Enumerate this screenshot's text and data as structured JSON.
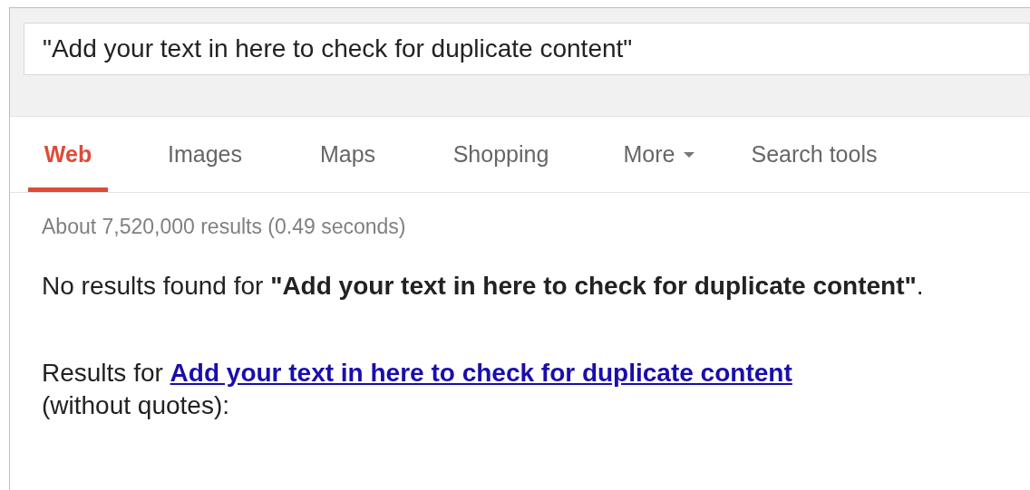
{
  "search": {
    "value": "\"Add your text in here to check for duplicate content\""
  },
  "tabs": [
    {
      "label": "Web",
      "selected": true,
      "kind": "tab"
    },
    {
      "label": "Images",
      "selected": false,
      "kind": "tab"
    },
    {
      "label": "Maps",
      "selected": false,
      "kind": "tab"
    },
    {
      "label": "Shopping",
      "selected": false,
      "kind": "tab"
    },
    {
      "label": "More",
      "selected": false,
      "kind": "menu"
    },
    {
      "label": "Search tools",
      "selected": false,
      "kind": "tab"
    }
  ],
  "result_stats": "About 7,520,000 results (0.49 seconds)",
  "no_results": "No results found for **\"Add your text in here to check for duplicate content\"**.",
  "results_for": {
    "prefix": "Results for",
    "link": "Add your text in here to check for duplicate content",
    "suffix": "(without quotes):"
  }
}
